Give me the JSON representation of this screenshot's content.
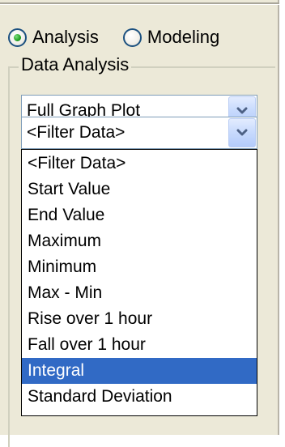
{
  "mode": {
    "options": [
      {
        "label": "Analysis",
        "selected": true
      },
      {
        "label": "Modeling",
        "selected": false
      }
    ]
  },
  "group": {
    "legend": "Data Analysis"
  },
  "plot_select": {
    "value": "Full Graph Plot",
    "icon": "chevron-down-icon"
  },
  "filter_select": {
    "value": "<Filter Data>",
    "icon": "chevron-down-icon",
    "open": true,
    "options": [
      "<Filter Data>",
      "Start Value",
      "End Value",
      "Maximum",
      "Minimum",
      "Max - Min",
      "Rise over 1 hour",
      "Fall over 1 hour",
      "Integral",
      "Standard Deviation"
    ],
    "highlighted": "Integral"
  },
  "colors": {
    "panel": "#ece9d8",
    "highlight": "#316ac5",
    "radio_accent": "#21a121",
    "combo_border": "#7f9db9",
    "combo_button": "#c9dbfd",
    "chevron": "#4d6185"
  }
}
